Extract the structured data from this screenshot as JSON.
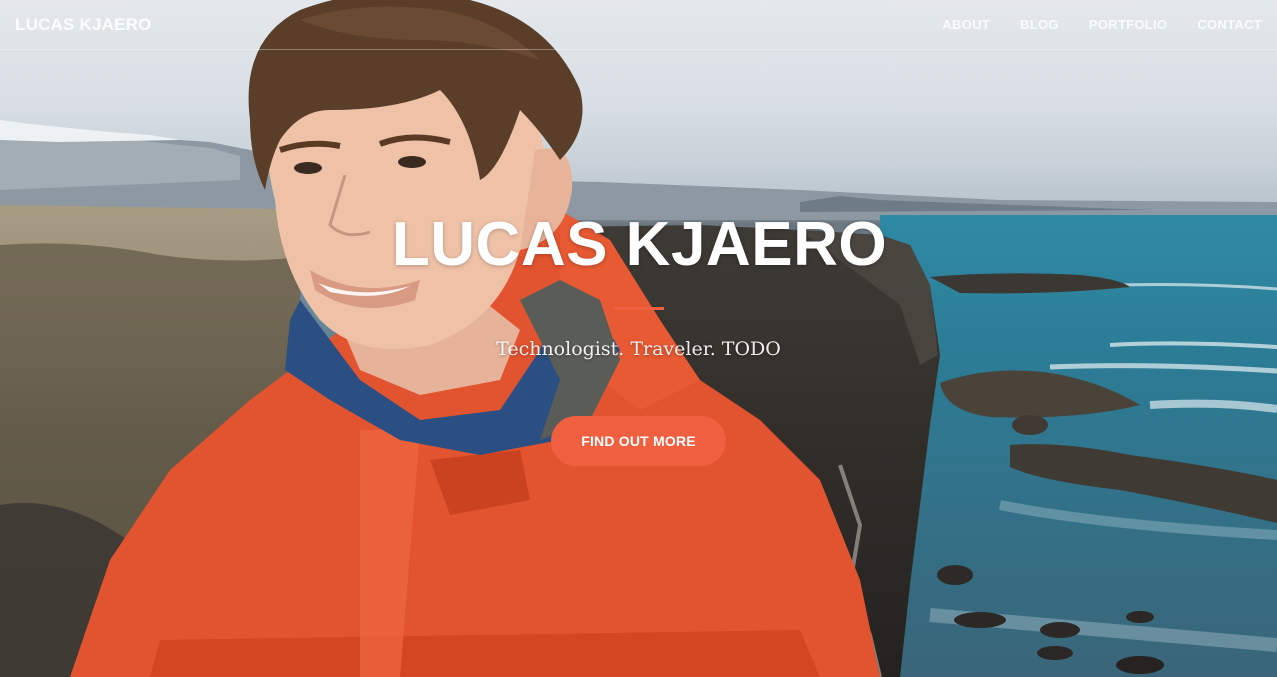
{
  "navbar": {
    "brand": "LUCAS KJAERO",
    "links": [
      {
        "label": "ABOUT"
      },
      {
        "label": "BLOG"
      },
      {
        "label": "PORTFOLIO"
      },
      {
        "label": "CONTACT"
      }
    ]
  },
  "hero": {
    "title": "LUCAS KJAERO",
    "subtitle": "Technologist. Traveler. TODO",
    "cta_label": "FIND OUT MORE",
    "divider_color": "#f05f40",
    "cta_color": "#f05f40"
  },
  "background": {
    "description_icon": "landscape-photo"
  }
}
